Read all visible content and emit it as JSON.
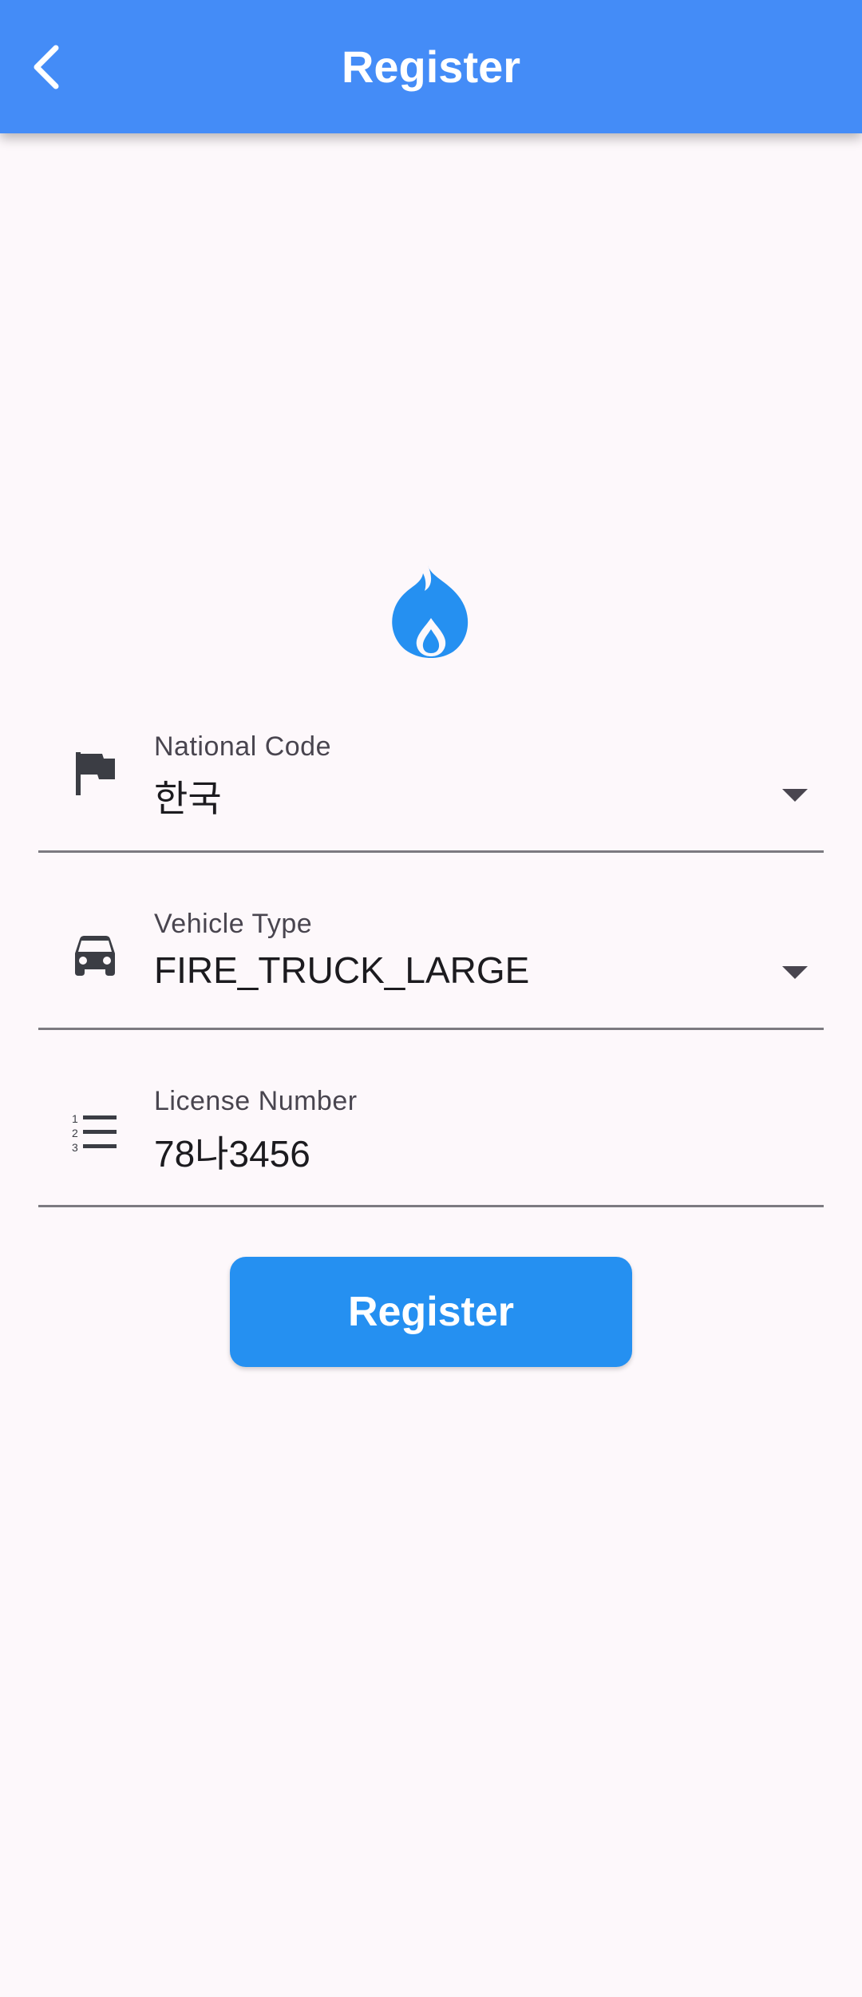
{
  "appbar": {
    "title": "Register",
    "back_icon": "chevron-left-icon",
    "background": "#448cf7"
  },
  "logo": {
    "icon": "flame-drop-icon",
    "color": "#2590f1"
  },
  "form": {
    "national_code": {
      "label": "National Code",
      "value": "한국",
      "icon": "flag-icon"
    },
    "vehicle_type": {
      "label": "Vehicle Type",
      "value": "FIRE_TRUCK_LARGE",
      "icon": "car-icon"
    },
    "license_number": {
      "label": "License Number",
      "value": "78나3456",
      "icon": "numbered-list-icon"
    }
  },
  "register_button": {
    "label": "Register",
    "color": "#2590f1"
  }
}
